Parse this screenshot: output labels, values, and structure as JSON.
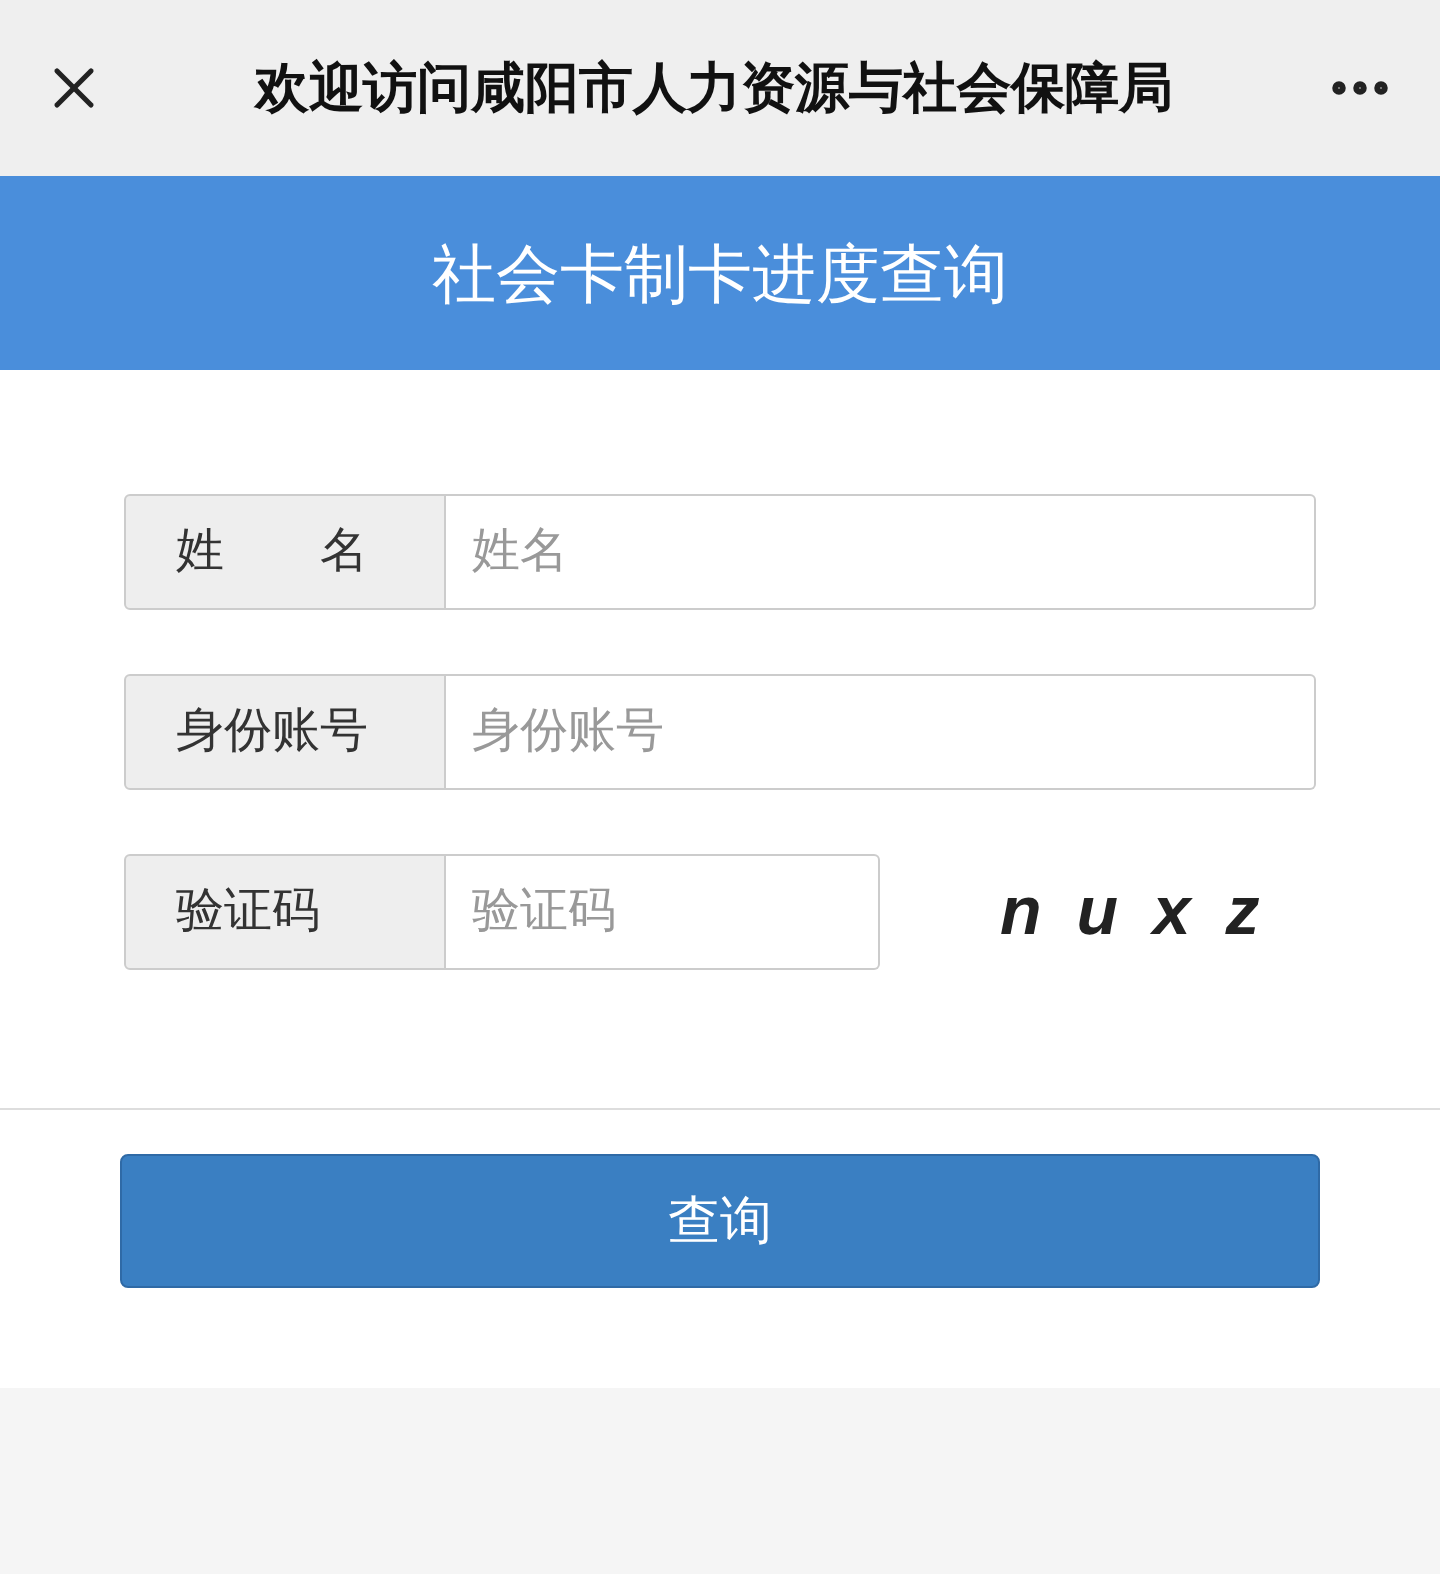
{
  "top_bar": {
    "title": "欢迎访问咸阳市人力资源与社会保障局"
  },
  "banner": {
    "title": "社会卡制卡进度查询"
  },
  "fields": [
    {
      "label": "姓　　名",
      "placeholder": "姓名",
      "kind": "wide"
    },
    {
      "label": "身份账号",
      "placeholder": "身份账号",
      "kind": "wide"
    },
    {
      "label": "验证码",
      "placeholder": "验证码",
      "kind": "captcha",
      "captcha": "n u x z"
    }
  ],
  "submit": {
    "label": "查询"
  }
}
